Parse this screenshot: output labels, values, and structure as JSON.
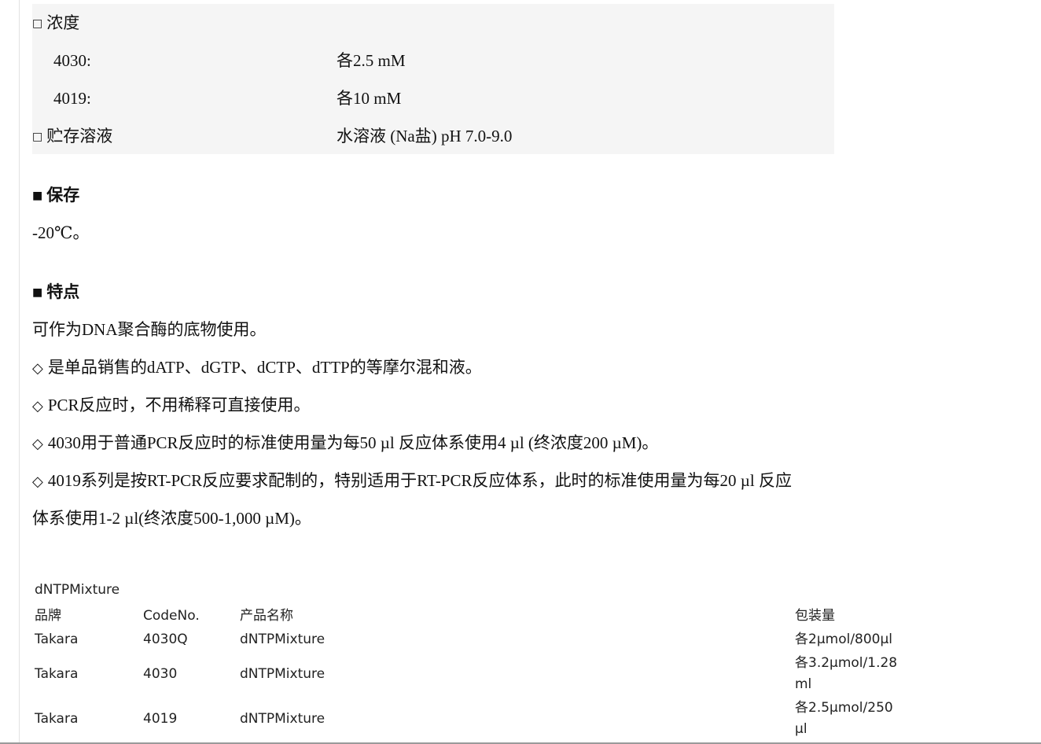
{
  "spec": {
    "concentration_label": "浓度",
    "rows": [
      {
        "key": "4030:",
        "value": "各2.5 mM"
      },
      {
        "key": "4019:",
        "value": "各10 mM"
      }
    ],
    "storage_solution_label": "贮存溶液",
    "storage_solution_value": "水溶液 (Na盐) pH 7.0-9.0",
    "box_glyph": "□"
  },
  "storage": {
    "heading": "保存",
    "text": "-20℃。"
  },
  "features": {
    "heading": "特点",
    "intro": "可作为DNA聚合酶的底物使用。",
    "bullet_glyph": "◇",
    "items": [
      "是单品销售的dATP、dGTP、dCTP、dTTP的等摩尔混和液。",
      "PCR反应时，不用稀释可直接使用。",
      "4030用于普通PCR反应时的标准使用量为每50 µl 反应体系使用4 µl (终浓度200 µM)。",
      "4019系列是按RT-PCR反应要求配制的，特别适用于RT-PCR反应体系，此时的标准使用量为每20 µl 反应"
    ],
    "continuation": "体系使用1-2 µl(终浓度500-1,000 µM)。"
  },
  "section_mark": "■",
  "product_table": {
    "caption": "dNTPMixture",
    "headers": {
      "brand": "品牌",
      "code": "CodeNo.",
      "name": "产品名称",
      "pack": "包装量"
    },
    "rows": [
      {
        "brand": "Takara",
        "code": "4030Q",
        "name": "dNTPMixture",
        "pack": "各2μmol/800μl"
      },
      {
        "brand": "Takara",
        "code": "4030",
        "name": "dNTPMixture",
        "pack": "各3.2μmol/1.28ml"
      },
      {
        "brand": "Takara",
        "code": "4019",
        "name": "dNTPMixture",
        "pack": "各2.5μmol/250μl"
      }
    ]
  }
}
